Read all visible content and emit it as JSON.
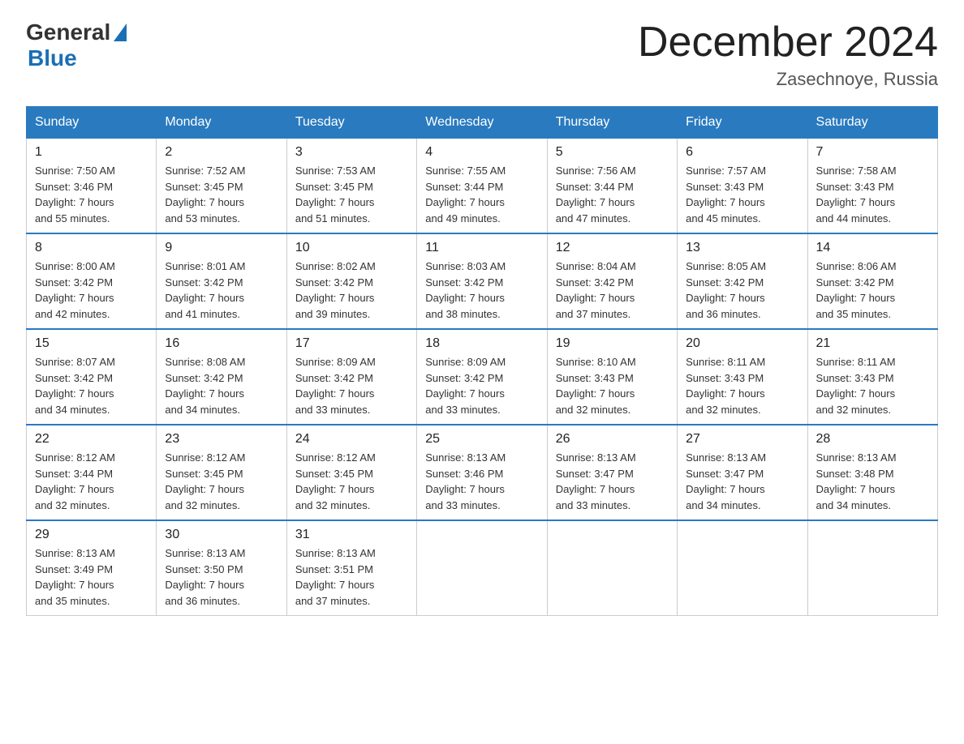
{
  "header": {
    "logo_general": "General",
    "logo_blue": "Blue",
    "month_title": "December 2024",
    "location": "Zasechnoye, Russia"
  },
  "days_of_week": [
    "Sunday",
    "Monday",
    "Tuesday",
    "Wednesday",
    "Thursday",
    "Friday",
    "Saturday"
  ],
  "weeks": [
    [
      {
        "day": "1",
        "sunrise": "Sunrise: 7:50 AM",
        "sunset": "Sunset: 3:46 PM",
        "daylight": "Daylight: 7 hours",
        "daylight2": "and 55 minutes."
      },
      {
        "day": "2",
        "sunrise": "Sunrise: 7:52 AM",
        "sunset": "Sunset: 3:45 PM",
        "daylight": "Daylight: 7 hours",
        "daylight2": "and 53 minutes."
      },
      {
        "day": "3",
        "sunrise": "Sunrise: 7:53 AM",
        "sunset": "Sunset: 3:45 PM",
        "daylight": "Daylight: 7 hours",
        "daylight2": "and 51 minutes."
      },
      {
        "day": "4",
        "sunrise": "Sunrise: 7:55 AM",
        "sunset": "Sunset: 3:44 PM",
        "daylight": "Daylight: 7 hours",
        "daylight2": "and 49 minutes."
      },
      {
        "day": "5",
        "sunrise": "Sunrise: 7:56 AM",
        "sunset": "Sunset: 3:44 PM",
        "daylight": "Daylight: 7 hours",
        "daylight2": "and 47 minutes."
      },
      {
        "day": "6",
        "sunrise": "Sunrise: 7:57 AM",
        "sunset": "Sunset: 3:43 PM",
        "daylight": "Daylight: 7 hours",
        "daylight2": "and 45 minutes."
      },
      {
        "day": "7",
        "sunrise": "Sunrise: 7:58 AM",
        "sunset": "Sunset: 3:43 PM",
        "daylight": "Daylight: 7 hours",
        "daylight2": "and 44 minutes."
      }
    ],
    [
      {
        "day": "8",
        "sunrise": "Sunrise: 8:00 AM",
        "sunset": "Sunset: 3:42 PM",
        "daylight": "Daylight: 7 hours",
        "daylight2": "and 42 minutes."
      },
      {
        "day": "9",
        "sunrise": "Sunrise: 8:01 AM",
        "sunset": "Sunset: 3:42 PM",
        "daylight": "Daylight: 7 hours",
        "daylight2": "and 41 minutes."
      },
      {
        "day": "10",
        "sunrise": "Sunrise: 8:02 AM",
        "sunset": "Sunset: 3:42 PM",
        "daylight": "Daylight: 7 hours",
        "daylight2": "and 39 minutes."
      },
      {
        "day": "11",
        "sunrise": "Sunrise: 8:03 AM",
        "sunset": "Sunset: 3:42 PM",
        "daylight": "Daylight: 7 hours",
        "daylight2": "and 38 minutes."
      },
      {
        "day": "12",
        "sunrise": "Sunrise: 8:04 AM",
        "sunset": "Sunset: 3:42 PM",
        "daylight": "Daylight: 7 hours",
        "daylight2": "and 37 minutes."
      },
      {
        "day": "13",
        "sunrise": "Sunrise: 8:05 AM",
        "sunset": "Sunset: 3:42 PM",
        "daylight": "Daylight: 7 hours",
        "daylight2": "and 36 minutes."
      },
      {
        "day": "14",
        "sunrise": "Sunrise: 8:06 AM",
        "sunset": "Sunset: 3:42 PM",
        "daylight": "Daylight: 7 hours",
        "daylight2": "and 35 minutes."
      }
    ],
    [
      {
        "day": "15",
        "sunrise": "Sunrise: 8:07 AM",
        "sunset": "Sunset: 3:42 PM",
        "daylight": "Daylight: 7 hours",
        "daylight2": "and 34 minutes."
      },
      {
        "day": "16",
        "sunrise": "Sunrise: 8:08 AM",
        "sunset": "Sunset: 3:42 PM",
        "daylight": "Daylight: 7 hours",
        "daylight2": "and 34 minutes."
      },
      {
        "day": "17",
        "sunrise": "Sunrise: 8:09 AM",
        "sunset": "Sunset: 3:42 PM",
        "daylight": "Daylight: 7 hours",
        "daylight2": "and 33 minutes."
      },
      {
        "day": "18",
        "sunrise": "Sunrise: 8:09 AM",
        "sunset": "Sunset: 3:42 PM",
        "daylight": "Daylight: 7 hours",
        "daylight2": "and 33 minutes."
      },
      {
        "day": "19",
        "sunrise": "Sunrise: 8:10 AM",
        "sunset": "Sunset: 3:43 PM",
        "daylight": "Daylight: 7 hours",
        "daylight2": "and 32 minutes."
      },
      {
        "day": "20",
        "sunrise": "Sunrise: 8:11 AM",
        "sunset": "Sunset: 3:43 PM",
        "daylight": "Daylight: 7 hours",
        "daylight2": "and 32 minutes."
      },
      {
        "day": "21",
        "sunrise": "Sunrise: 8:11 AM",
        "sunset": "Sunset: 3:43 PM",
        "daylight": "Daylight: 7 hours",
        "daylight2": "and 32 minutes."
      }
    ],
    [
      {
        "day": "22",
        "sunrise": "Sunrise: 8:12 AM",
        "sunset": "Sunset: 3:44 PM",
        "daylight": "Daylight: 7 hours",
        "daylight2": "and 32 minutes."
      },
      {
        "day": "23",
        "sunrise": "Sunrise: 8:12 AM",
        "sunset": "Sunset: 3:45 PM",
        "daylight": "Daylight: 7 hours",
        "daylight2": "and 32 minutes."
      },
      {
        "day": "24",
        "sunrise": "Sunrise: 8:12 AM",
        "sunset": "Sunset: 3:45 PM",
        "daylight": "Daylight: 7 hours",
        "daylight2": "and 32 minutes."
      },
      {
        "day": "25",
        "sunrise": "Sunrise: 8:13 AM",
        "sunset": "Sunset: 3:46 PM",
        "daylight": "Daylight: 7 hours",
        "daylight2": "and 33 minutes."
      },
      {
        "day": "26",
        "sunrise": "Sunrise: 8:13 AM",
        "sunset": "Sunset: 3:47 PM",
        "daylight": "Daylight: 7 hours",
        "daylight2": "and 33 minutes."
      },
      {
        "day": "27",
        "sunrise": "Sunrise: 8:13 AM",
        "sunset": "Sunset: 3:47 PM",
        "daylight": "Daylight: 7 hours",
        "daylight2": "and 34 minutes."
      },
      {
        "day": "28",
        "sunrise": "Sunrise: 8:13 AM",
        "sunset": "Sunset: 3:48 PM",
        "daylight": "Daylight: 7 hours",
        "daylight2": "and 34 minutes."
      }
    ],
    [
      {
        "day": "29",
        "sunrise": "Sunrise: 8:13 AM",
        "sunset": "Sunset: 3:49 PM",
        "daylight": "Daylight: 7 hours",
        "daylight2": "and 35 minutes."
      },
      {
        "day": "30",
        "sunrise": "Sunrise: 8:13 AM",
        "sunset": "Sunset: 3:50 PM",
        "daylight": "Daylight: 7 hours",
        "daylight2": "and 36 minutes."
      },
      {
        "day": "31",
        "sunrise": "Sunrise: 8:13 AM",
        "sunset": "Sunset: 3:51 PM",
        "daylight": "Daylight: 7 hours",
        "daylight2": "and 37 minutes."
      },
      null,
      null,
      null,
      null
    ]
  ]
}
